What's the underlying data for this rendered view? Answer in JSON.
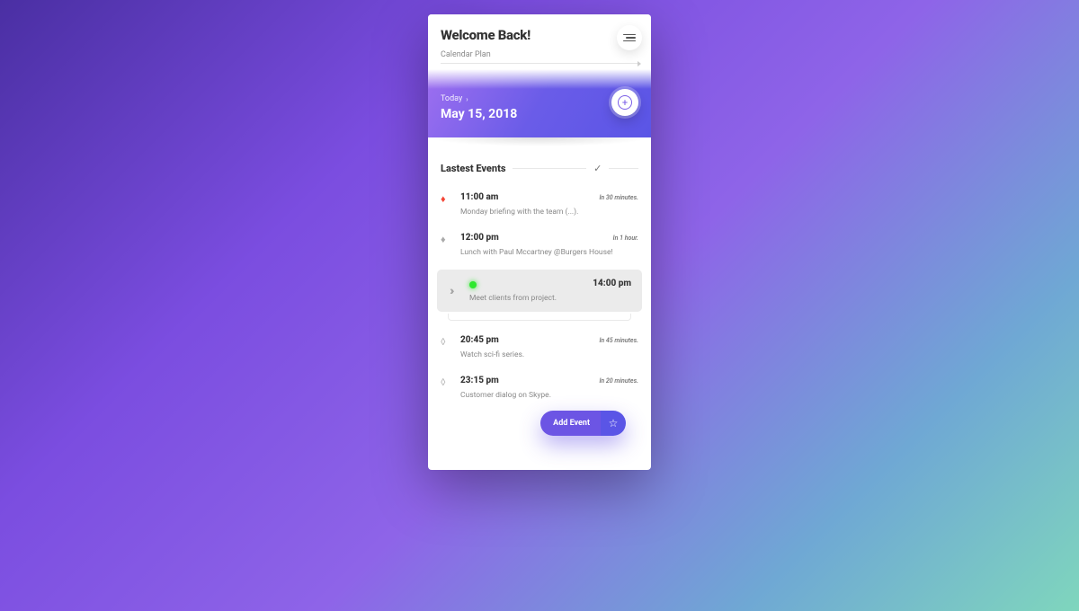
{
  "header": {
    "welcome": "Welcome Back!",
    "subtitle": "Calendar Plan"
  },
  "datebar": {
    "today_label": "Today",
    "date": "May 15, 2018"
  },
  "events_section": {
    "title": "Lastest Events"
  },
  "events": [
    {
      "icon": "flame-red",
      "time": "11:00 am",
      "rel": "In 30 minutes.",
      "desc": "Monday briefing with the team (...)."
    },
    {
      "icon": "flame-grey",
      "time": "12:00 pm",
      "rel": "In 1 hour.",
      "desc": "Lunch with Paul Mccartney @Burgers House!"
    }
  ],
  "highlight_event": {
    "time": "14:00 pm",
    "desc": "Meet clients from project."
  },
  "events_after": [
    {
      "icon": "drop-grey",
      "time": "20:45 pm",
      "rel": "In 45 minutes.",
      "desc": "Watch sci-fi series."
    },
    {
      "icon": "drop-grey",
      "time": "23:15 pm",
      "rel": "In 20 minutes.",
      "desc": "Customer dialog on Skype."
    }
  ],
  "footer": {
    "add_event": "Add Event"
  }
}
